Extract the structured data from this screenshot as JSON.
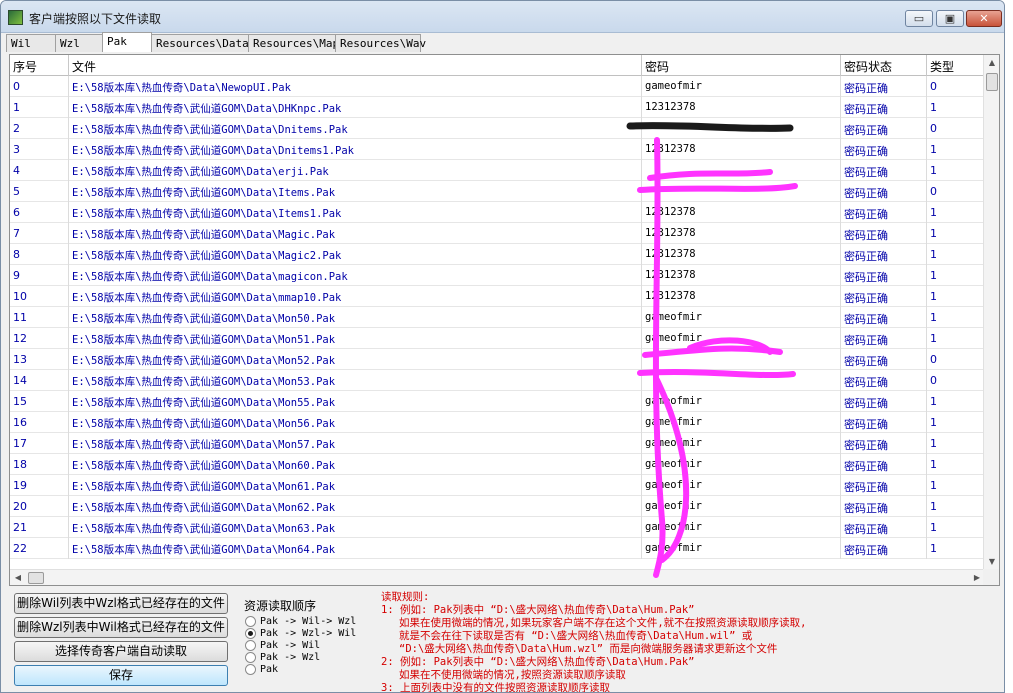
{
  "window": {
    "title": "客户端按照以下文件读取"
  },
  "title_buttons": {
    "minimize": "▭",
    "maximize": "▣",
    "close": "✕"
  },
  "tabs": [
    "Wil",
    "Wzl",
    "Pak",
    "Resources\\Data",
    "Resources\\Map",
    "Resources\\Wav"
  ],
  "active_tab": "Pak",
  "grid": {
    "columns": [
      "序号",
      "文件",
      "密码",
      "密码状态",
      "类型"
    ],
    "rows": [
      [
        "0",
        "E:\\58版本库\\热血传奇\\Data\\NewopUI.Pak",
        "gameofmir",
        "密码正确",
        "0"
      ],
      [
        "1",
        "E:\\58版本库\\热血传奇\\武仙道GOM\\Data\\DHKnpc.Pak",
        "12312378",
        "密码正确",
        "1"
      ],
      [
        "2",
        "E:\\58版本库\\热血传奇\\武仙道GOM\\Data\\Dnitems.Pak",
        "",
        "密码正确",
        "0"
      ],
      [
        "3",
        "E:\\58版本库\\热血传奇\\武仙道GOM\\Data\\Dnitems1.Pak",
        "12312378",
        "密码正确",
        "1"
      ],
      [
        "4",
        "E:\\58版本库\\热血传奇\\武仙道GOM\\Data\\erji.Pak",
        "",
        "密码正确",
        "1"
      ],
      [
        "5",
        "E:\\58版本库\\热血传奇\\武仙道GOM\\Data\\Items.Pak",
        "",
        "密码正确",
        "0"
      ],
      [
        "6",
        "E:\\58版本库\\热血传奇\\武仙道GOM\\Data\\Items1.Pak",
        "12312378",
        "密码正确",
        "1"
      ],
      [
        "7",
        "E:\\58版本库\\热血传奇\\武仙道GOM\\Data\\Magic.Pak",
        "12312378",
        "密码正确",
        "1"
      ],
      [
        "8",
        "E:\\58版本库\\热血传奇\\武仙道GOM\\Data\\Magic2.Pak",
        "12312378",
        "密码正确",
        "1"
      ],
      [
        "9",
        "E:\\58版本库\\热血传奇\\武仙道GOM\\Data\\magicon.Pak",
        "12312378",
        "密码正确",
        "1"
      ],
      [
        "10",
        "E:\\58版本库\\热血传奇\\武仙道GOM\\Data\\mmap10.Pak",
        "12312378",
        "密码正确",
        "1"
      ],
      [
        "11",
        "E:\\58版本库\\热血传奇\\武仙道GOM\\Data\\Mon50.Pak",
        "gameofmir",
        "密码正确",
        "1"
      ],
      [
        "12",
        "E:\\58版本库\\热血传奇\\武仙道GOM\\Data\\Mon51.Pak",
        "gameofmir",
        "密码正确",
        "1"
      ],
      [
        "13",
        "E:\\58版本库\\热血传奇\\武仙道GOM\\Data\\Mon52.Pak",
        "",
        "密码正确",
        "0"
      ],
      [
        "14",
        "E:\\58版本库\\热血传奇\\武仙道GOM\\Data\\Mon53.Pak",
        "",
        "密码正确",
        "0"
      ],
      [
        "15",
        "E:\\58版本库\\热血传奇\\武仙道GOM\\Data\\Mon55.Pak",
        "gameofmir",
        "密码正确",
        "1"
      ],
      [
        "16",
        "E:\\58版本库\\热血传奇\\武仙道GOM\\Data\\Mon56.Pak",
        "gameofmir",
        "密码正确",
        "1"
      ],
      [
        "17",
        "E:\\58版本库\\热血传奇\\武仙道GOM\\Data\\Mon57.Pak",
        "gameofmir",
        "密码正确",
        "1"
      ],
      [
        "18",
        "E:\\58版本库\\热血传奇\\武仙道GOM\\Data\\Mon60.Pak",
        "gameofmir",
        "密码正确",
        "1"
      ],
      [
        "19",
        "E:\\58版本库\\热血传奇\\武仙道GOM\\Data\\Mon61.Pak",
        "gameofmir",
        "密码正确",
        "1"
      ],
      [
        "20",
        "E:\\58版本库\\热血传奇\\武仙道GOM\\Data\\Mon62.Pak",
        "gameofmir",
        "密码正确",
        "1"
      ],
      [
        "21",
        "E:\\58版本库\\热血传奇\\武仙道GOM\\Data\\Mon63.Pak",
        "gameofmir",
        "密码正确",
        "1"
      ],
      [
        "22",
        "E:\\58版本库\\热血传奇\\武仙道GOM\\Data\\Mon64.Pak",
        "gameofmir",
        "密码正确",
        "1"
      ]
    ]
  },
  "buttons": {
    "delete_wil": "删除Wil列表中Wzl格式已经存在的文件",
    "delete_wzl": "删除Wzl列表中Wil格式已经存在的文件",
    "auto_read": "选择传奇客户端自动读取",
    "save": "保存"
  },
  "order_group": {
    "label": "资源读取顺序",
    "options": [
      "Pak -> Wil-> Wzl",
      "Pak -> Wzl-> Wil",
      "Pak -> Wil",
      "Pak -> Wzl",
      "Pak"
    ],
    "selected_index": 1
  },
  "rules": {
    "title": "读取规则:",
    "lines": [
      {
        "text": "1: 例如: Pak列表中 “D:\\盛大网络\\热血传奇\\Data\\Hum.Pak”",
        "indent": false
      },
      {
        "text": "如果在使用微端的情况,如果玩家客户端不存在这个文件,就不在按照资源读取顺序读取,",
        "indent": true
      },
      {
        "text": "就是不会在往下读取是否有 “D:\\盛大网络\\热血传奇\\Data\\Hum.wil” 或",
        "indent": true
      },
      {
        "text": "“D:\\盛大网络\\热血传奇\\Data\\Hum.wzl” 而是向微端服务器请求更新这个文件",
        "indent": true
      },
      {
        "text": "2: 例如: Pak列表中 “D:\\盛大网络\\热血传奇\\Data\\Hum.Pak”",
        "indent": false
      },
      {
        "text": "如果在不使用微端的情况,按照资源读取顺序读取",
        "indent": true
      },
      {
        "text": "3: 上面列表中没有的文件按照资源读取顺序读取",
        "indent": false
      }
    ]
  },
  "colors": {
    "link_blue": "#0000a8",
    "rules_red": "#d40000",
    "scribble": "#ff33ff"
  }
}
